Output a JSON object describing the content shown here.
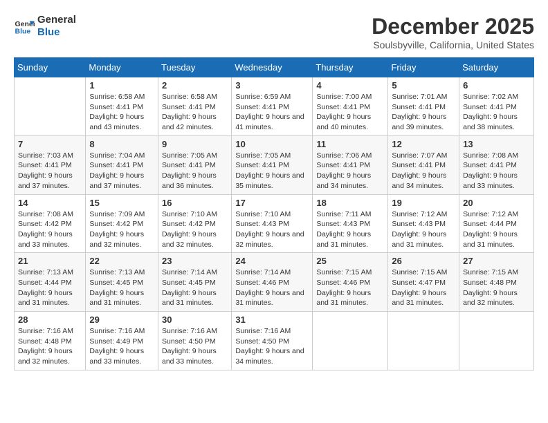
{
  "header": {
    "logo_line1": "General",
    "logo_line2": "Blue",
    "month_title": "December 2025",
    "location": "Soulsbyville, California, United States"
  },
  "weekdays": [
    "Sunday",
    "Monday",
    "Tuesday",
    "Wednesday",
    "Thursday",
    "Friday",
    "Saturday"
  ],
  "weeks": [
    [
      {
        "day": "",
        "sunrise": "",
        "sunset": "",
        "daylight": ""
      },
      {
        "day": "1",
        "sunrise": "Sunrise: 6:58 AM",
        "sunset": "Sunset: 4:41 PM",
        "daylight": "Daylight: 9 hours and 43 minutes."
      },
      {
        "day": "2",
        "sunrise": "Sunrise: 6:58 AM",
        "sunset": "Sunset: 4:41 PM",
        "daylight": "Daylight: 9 hours and 42 minutes."
      },
      {
        "day": "3",
        "sunrise": "Sunrise: 6:59 AM",
        "sunset": "Sunset: 4:41 PM",
        "daylight": "Daylight: 9 hours and 41 minutes."
      },
      {
        "day": "4",
        "sunrise": "Sunrise: 7:00 AM",
        "sunset": "Sunset: 4:41 PM",
        "daylight": "Daylight: 9 hours and 40 minutes."
      },
      {
        "day": "5",
        "sunrise": "Sunrise: 7:01 AM",
        "sunset": "Sunset: 4:41 PM",
        "daylight": "Daylight: 9 hours and 39 minutes."
      },
      {
        "day": "6",
        "sunrise": "Sunrise: 7:02 AM",
        "sunset": "Sunset: 4:41 PM",
        "daylight": "Daylight: 9 hours and 38 minutes."
      }
    ],
    [
      {
        "day": "7",
        "sunrise": "Sunrise: 7:03 AM",
        "sunset": "Sunset: 4:41 PM",
        "daylight": "Daylight: 9 hours and 37 minutes."
      },
      {
        "day": "8",
        "sunrise": "Sunrise: 7:04 AM",
        "sunset": "Sunset: 4:41 PM",
        "daylight": "Daylight: 9 hours and 37 minutes."
      },
      {
        "day": "9",
        "sunrise": "Sunrise: 7:05 AM",
        "sunset": "Sunset: 4:41 PM",
        "daylight": "Daylight: 9 hours and 36 minutes."
      },
      {
        "day": "10",
        "sunrise": "Sunrise: 7:05 AM",
        "sunset": "Sunset: 4:41 PM",
        "daylight": "Daylight: 9 hours and 35 minutes."
      },
      {
        "day": "11",
        "sunrise": "Sunrise: 7:06 AM",
        "sunset": "Sunset: 4:41 PM",
        "daylight": "Daylight: 9 hours and 34 minutes."
      },
      {
        "day": "12",
        "sunrise": "Sunrise: 7:07 AM",
        "sunset": "Sunset: 4:41 PM",
        "daylight": "Daylight: 9 hours and 34 minutes."
      },
      {
        "day": "13",
        "sunrise": "Sunrise: 7:08 AM",
        "sunset": "Sunset: 4:41 PM",
        "daylight": "Daylight: 9 hours and 33 minutes."
      }
    ],
    [
      {
        "day": "14",
        "sunrise": "Sunrise: 7:08 AM",
        "sunset": "Sunset: 4:42 PM",
        "daylight": "Daylight: 9 hours and 33 minutes."
      },
      {
        "day": "15",
        "sunrise": "Sunrise: 7:09 AM",
        "sunset": "Sunset: 4:42 PM",
        "daylight": "Daylight: 9 hours and 32 minutes."
      },
      {
        "day": "16",
        "sunrise": "Sunrise: 7:10 AM",
        "sunset": "Sunset: 4:42 PM",
        "daylight": "Daylight: 9 hours and 32 minutes."
      },
      {
        "day": "17",
        "sunrise": "Sunrise: 7:10 AM",
        "sunset": "Sunset: 4:43 PM",
        "daylight": "Daylight: 9 hours and 32 minutes."
      },
      {
        "day": "18",
        "sunrise": "Sunrise: 7:11 AM",
        "sunset": "Sunset: 4:43 PM",
        "daylight": "Daylight: 9 hours and 31 minutes."
      },
      {
        "day": "19",
        "sunrise": "Sunrise: 7:12 AM",
        "sunset": "Sunset: 4:43 PM",
        "daylight": "Daylight: 9 hours and 31 minutes."
      },
      {
        "day": "20",
        "sunrise": "Sunrise: 7:12 AM",
        "sunset": "Sunset: 4:44 PM",
        "daylight": "Daylight: 9 hours and 31 minutes."
      }
    ],
    [
      {
        "day": "21",
        "sunrise": "Sunrise: 7:13 AM",
        "sunset": "Sunset: 4:44 PM",
        "daylight": "Daylight: 9 hours and 31 minutes."
      },
      {
        "day": "22",
        "sunrise": "Sunrise: 7:13 AM",
        "sunset": "Sunset: 4:45 PM",
        "daylight": "Daylight: 9 hours and 31 minutes."
      },
      {
        "day": "23",
        "sunrise": "Sunrise: 7:14 AM",
        "sunset": "Sunset: 4:45 PM",
        "daylight": "Daylight: 9 hours and 31 minutes."
      },
      {
        "day": "24",
        "sunrise": "Sunrise: 7:14 AM",
        "sunset": "Sunset: 4:46 PM",
        "daylight": "Daylight: 9 hours and 31 minutes."
      },
      {
        "day": "25",
        "sunrise": "Sunrise: 7:15 AM",
        "sunset": "Sunset: 4:46 PM",
        "daylight": "Daylight: 9 hours and 31 minutes."
      },
      {
        "day": "26",
        "sunrise": "Sunrise: 7:15 AM",
        "sunset": "Sunset: 4:47 PM",
        "daylight": "Daylight: 9 hours and 31 minutes."
      },
      {
        "day": "27",
        "sunrise": "Sunrise: 7:15 AM",
        "sunset": "Sunset: 4:48 PM",
        "daylight": "Daylight: 9 hours and 32 minutes."
      }
    ],
    [
      {
        "day": "28",
        "sunrise": "Sunrise: 7:16 AM",
        "sunset": "Sunset: 4:48 PM",
        "daylight": "Daylight: 9 hours and 32 minutes."
      },
      {
        "day": "29",
        "sunrise": "Sunrise: 7:16 AM",
        "sunset": "Sunset: 4:49 PM",
        "daylight": "Daylight: 9 hours and 33 minutes."
      },
      {
        "day": "30",
        "sunrise": "Sunrise: 7:16 AM",
        "sunset": "Sunset: 4:50 PM",
        "daylight": "Daylight: 9 hours and 33 minutes."
      },
      {
        "day": "31",
        "sunrise": "Sunrise: 7:16 AM",
        "sunset": "Sunset: 4:50 PM",
        "daylight": "Daylight: 9 hours and 34 minutes."
      },
      {
        "day": "",
        "sunrise": "",
        "sunset": "",
        "daylight": ""
      },
      {
        "day": "",
        "sunrise": "",
        "sunset": "",
        "daylight": ""
      },
      {
        "day": "",
        "sunrise": "",
        "sunset": "",
        "daylight": ""
      }
    ]
  ]
}
